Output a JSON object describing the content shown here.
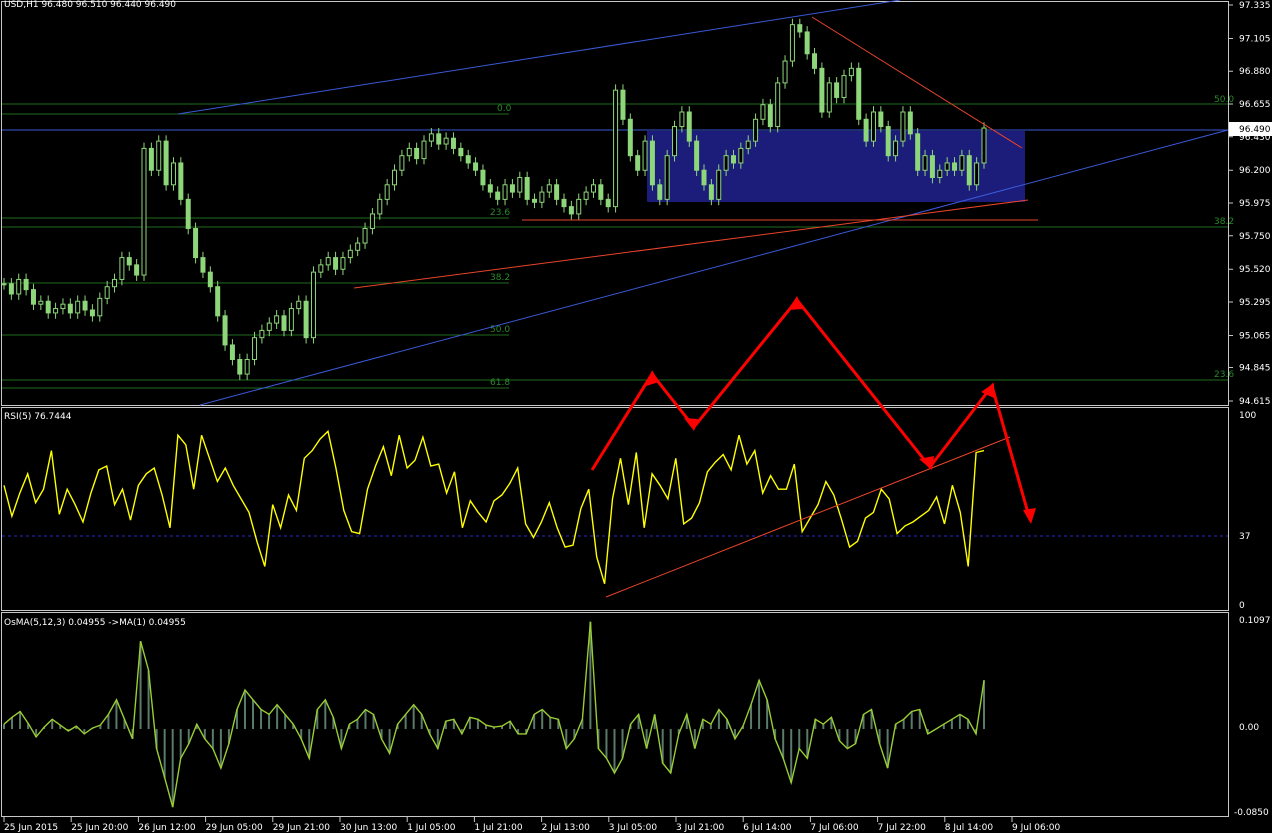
{
  "header": {
    "main": "USD,H1  96.480  96.510  96.440  96.490",
    "rsi": "RSI(5) 76.7444",
    "osma": "OsMA(5,12,3) 0.04955  ->MA(1) 0.04955"
  },
  "price_axis": [
    "97.335",
    "97.105",
    "96.880",
    "96.655",
    "96.430",
    "96.200",
    "95.975",
    "95.750",
    "95.520",
    "95.295",
    "95.065",
    "94.845",
    "94.615"
  ],
  "price_ticks": [
    97.335,
    97.105,
    96.88,
    96.655,
    96.43,
    96.2,
    95.975,
    95.75,
    95.52,
    95.295,
    95.065,
    94.845,
    94.615
  ],
  "current_price": "96.490",
  "rsi_axis": [
    "100",
    "37",
    "0"
  ],
  "osma_axis": [
    "0.1097",
    "0.00",
    "-0.0850"
  ],
  "time_axis": [
    "25 Jun 2015",
    "25 Jun 20:00",
    "26 Jun 12:00",
    "29 Jun 05:00",
    "29 Jun 21:00",
    "30 Jun 13:00",
    "1 Jul 05:00",
    "1 Jul 21:00",
    "2 Jul 13:00",
    "3 Jul 05:00",
    "3 Jul 21:00",
    "6 Jul 14:00",
    "7 Jul 06:00",
    "7 Jul 22:00",
    "8 Jul 14:00",
    "9 Jul 06:00"
  ],
  "fib_labels": {
    "left": [
      "0.0",
      "23.6",
      "38.2",
      "50.0",
      "61.8"
    ],
    "right": [
      "50.0",
      "38.2",
      "23.6"
    ]
  },
  "colors": {
    "bull": "#8ed67a",
    "bear": "#8ed67a",
    "rsi": "#ffff00",
    "osma": "#9acd32",
    "channel": "#3a5ad8",
    "trend": "#e8452a",
    "arrow": "#ff0000",
    "fib": "#1f6b1f",
    "box": "#1c1c7a"
  },
  "chart_data": [
    {
      "type": "candlestick",
      "title": "USD,H1",
      "ylim": [
        94.615,
        97.335
      ],
      "last": {
        "open": 96.48,
        "high": 96.51,
        "low": 96.44,
        "close": 96.49
      },
      "closes": [
        95.42,
        95.35,
        95.45,
        95.38,
        95.28,
        95.3,
        95.22,
        95.25,
        95.28,
        95.22,
        95.3,
        95.24,
        95.2,
        95.32,
        95.4,
        95.45,
        95.6,
        95.55,
        95.48,
        96.35,
        96.2,
        96.4,
        96.1,
        96.25,
        96.0,
        95.8,
        95.6,
        95.5,
        95.4,
        95.2,
        95.0,
        94.9,
        94.8,
        94.9,
        95.05,
        95.1,
        95.15,
        95.2,
        95.1,
        95.25,
        95.3,
        95.05,
        95.5,
        95.55,
        95.6,
        95.52,
        95.6,
        95.65,
        95.7,
        95.8,
        95.9,
        96.0,
        96.1,
        96.2,
        96.3,
        96.35,
        96.28,
        96.4,
        96.45,
        96.38,
        96.42,
        96.35,
        96.3,
        96.25,
        96.2,
        96.1,
        96.05,
        96.0,
        96.1,
        96.05,
        96.15,
        96.0,
        95.98,
        96.05,
        96.1,
        96.0,
        95.95,
        95.9,
        96.0,
        96.05,
        96.1,
        96.0,
        95.95,
        96.75,
        96.55,
        96.3,
        96.2,
        96.4,
        96.1,
        96.0,
        96.3,
        96.5,
        96.6,
        96.4,
        96.2,
        96.1,
        96.0,
        96.2,
        96.3,
        96.25,
        96.35,
        96.4,
        96.55,
        96.65,
        96.5,
        96.8,
        96.95,
        97.2,
        97.15,
        97.0,
        96.9,
        96.6,
        96.8,
        96.7,
        96.85,
        96.9,
        96.55,
        96.4,
        96.6,
        96.5,
        96.3,
        96.4,
        96.6,
        96.45,
        96.2,
        96.3,
        96.15,
        96.2,
        96.25,
        96.2,
        96.3,
        96.1,
        96.25,
        96.49
      ],
      "annotations": [
        "0.0",
        "23.6",
        "38.2",
        "50.0",
        "61.8"
      ]
    },
    {
      "type": "line",
      "title": "RSI(5) 76.7444",
      "ylim": [
        0,
        100
      ],
      "level": 37,
      "values": [
        62,
        46,
        58,
        68,
        53,
        60,
        80,
        47,
        60,
        52,
        43,
        58,
        70,
        72,
        52,
        60,
        44,
        62,
        68,
        71,
        57,
        40,
        88,
        83,
        60,
        88,
        76,
        64,
        71,
        62,
        55,
        48,
        33,
        20,
        52,
        40,
        57,
        49,
        76,
        80,
        86,
        90,
        71,
        49,
        38,
        37,
        60,
        72,
        82,
        67,
        88,
        71,
        75,
        87,
        72,
        73,
        58,
        69,
        40,
        54,
        48,
        43,
        54,
        57,
        63,
        71,
        42,
        35,
        43,
        53,
        40,
        30,
        31,
        50,
        60,
        25,
        11,
        55,
        76,
        52,
        79,
        40,
        68,
        62,
        55,
        76,
        42,
        45,
        53,
        69,
        74,
        78,
        70,
        88,
        73,
        80,
        58,
        67,
        60,
        60,
        73,
        38,
        45,
        52,
        64,
        57,
        44,
        30,
        33,
        45,
        48,
        60,
        55,
        37,
        41,
        43,
        46,
        49,
        56,
        42,
        62,
        48,
        20,
        79,
        80
      ],
      "annotations": []
    },
    {
      "type": "bar",
      "title": "OsMA(5,12,3) 0.04955",
      "ylim": [
        -0.085,
        0.1097
      ],
      "values": [
        0.005,
        0.012,
        0.018,
        0.006,
        -0.008,
        0.002,
        0.01,
        0.004,
        -0.002,
        0.003,
        -0.005,
        0.001,
        0.004,
        0.015,
        0.03,
        0.01,
        -0.01,
        0.09,
        0.06,
        -0.02,
        -0.05,
        -0.08,
        -0.03,
        -0.015,
        0.005,
        -0.01,
        -0.02,
        -0.04,
        -0.015,
        0.02,
        0.04,
        0.03,
        0.02,
        0.015,
        0.025,
        0.015,
        0.005,
        -0.01,
        -0.03,
        0.02,
        0.03,
        0.012,
        -0.02,
        0.005,
        0.01,
        0.02,
        0.015,
        -0.01,
        -0.025,
        0.005,
        0.015,
        0.025,
        0.015,
        -0.005,
        -0.02,
        0.008,
        0.01,
        -0.005,
        0.012,
        0.01,
        0.004,
        0.002,
        0.003,
        0.008,
        -0.005,
        -0.005,
        0.015,
        0.02,
        0.012,
        0.01,
        -0.02,
        -0.01,
        0.01,
        0.11,
        -0.02,
        -0.03,
        -0.045,
        -0.03,
        0.005,
        0.015,
        -0.02,
        0.015,
        -0.035,
        -0.045,
        -0.005,
        0.015,
        -0.02,
        0.01,
        0.005,
        0.02,
        0.01,
        -0.01,
        0.003,
        0.025,
        0.05,
        0.03,
        -0.01,
        -0.03,
        -0.055,
        -0.02,
        -0.03,
        0.01,
        0.005,
        0.012,
        -0.012,
        -0.02,
        -0.015,
        0.015,
        0.02,
        -0.015,
        -0.04,
        0.005,
        0.01,
        0.018,
        0.02,
        -0.005,
        0.0,
        0.005,
        0.01,
        0.015,
        0.01,
        -0.005,
        0.05
      ],
      "annotations": []
    }
  ]
}
